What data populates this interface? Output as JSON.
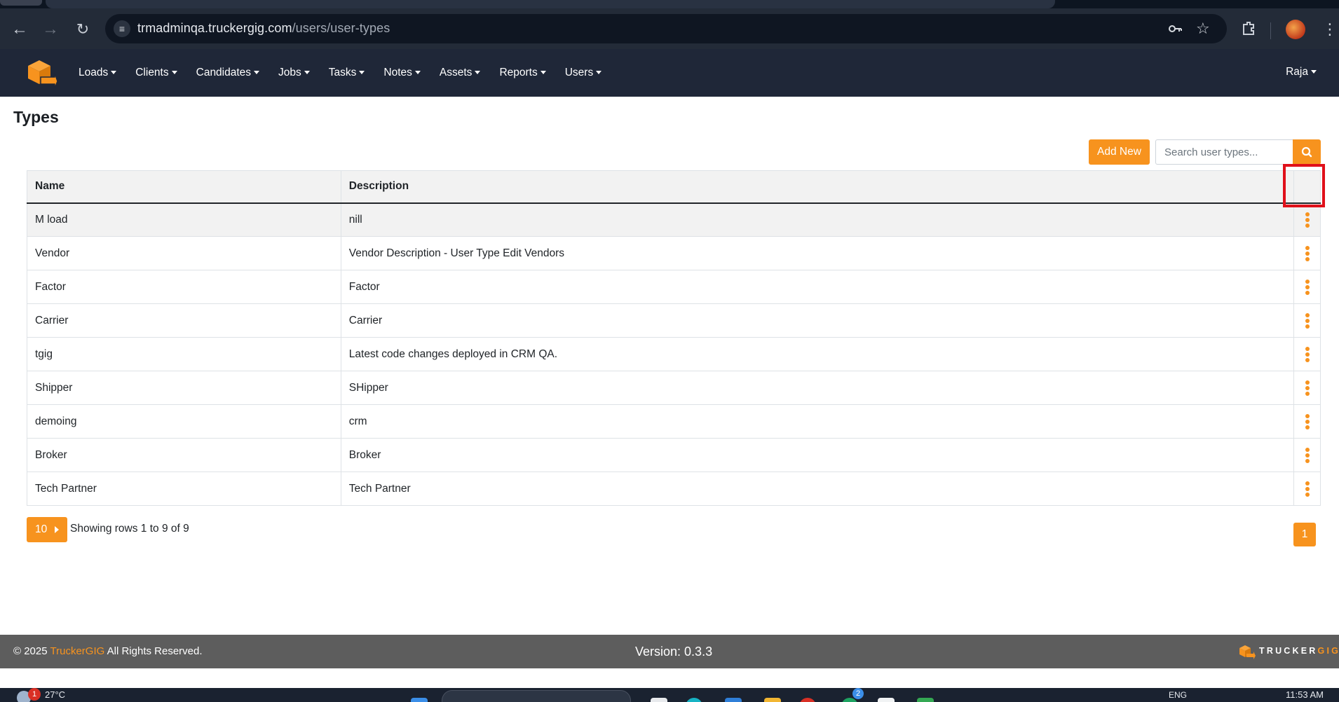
{
  "browser": {
    "url_host": "trmadminqa.truckergig.com",
    "url_path": "/users/user-types",
    "icons": [
      "back-icon",
      "forward-icon",
      "reload-icon",
      "site-info-icon",
      "key-icon",
      "star-icon",
      "extensions-icon",
      "profile-avatar",
      "more-icon"
    ]
  },
  "navbar": {
    "menu": [
      {
        "label": "Loads"
      },
      {
        "label": "Clients"
      },
      {
        "label": "Candidates"
      },
      {
        "label": "Jobs"
      },
      {
        "label": "Tasks"
      },
      {
        "label": "Notes"
      },
      {
        "label": "Assets"
      },
      {
        "label": "Reports"
      },
      {
        "label": "Users"
      }
    ],
    "user": "Raja"
  },
  "page": {
    "title": "Types",
    "add_new_label": "Add New",
    "search_placeholder": "Search user types...",
    "table": {
      "headers": {
        "name": "Name",
        "description": "Description",
        "actions": ""
      },
      "rows": [
        {
          "name": "M load",
          "description": "nill"
        },
        {
          "name": "Vendor",
          "description": "Vendor Description - User Type Edit Vendors"
        },
        {
          "name": "Factor",
          "description": "Factor"
        },
        {
          "name": "Carrier",
          "description": "Carrier"
        },
        {
          "name": "tgig",
          "description": "Latest code changes deployed in CRM QA."
        },
        {
          "name": "Shipper",
          "description": "SHipper"
        },
        {
          "name": "demoing",
          "description": "crm"
        },
        {
          "name": "Broker",
          "description": "Broker"
        },
        {
          "name": "Tech Partner",
          "description": "Tech Partner"
        }
      ]
    },
    "page_size": "10",
    "rows_info": "Showing rows 1 to 9 of 9",
    "current_page": "1"
  },
  "footer": {
    "copyright_prefix": "© 2025 ",
    "brand": "TruckerGIG",
    "copyright_suffix": " All Rights Reserved.",
    "version": "Version: 0.3.3",
    "logo_text_a": "TRUCKER",
    "logo_text_b": "GIG"
  },
  "taskbar": {
    "notification_count": "1",
    "temperature": "27°C",
    "badge_count": "2",
    "language": "ENG",
    "time": "11:53 AM"
  },
  "colors": {
    "accent": "#f7931e",
    "navbar_bg": "#1f2738",
    "footer_bg": "#5d5d5d",
    "highlight": "#e0101a"
  }
}
